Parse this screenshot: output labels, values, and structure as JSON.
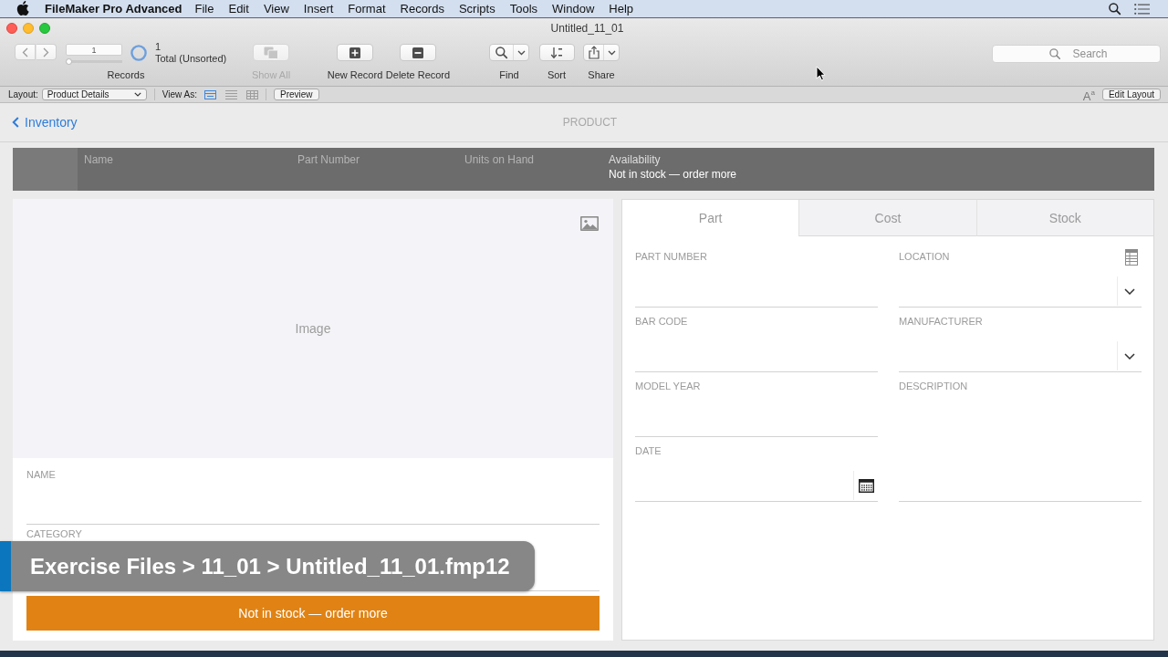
{
  "menubar": {
    "app": "FileMaker Pro Advanced",
    "menus": [
      "File",
      "Edit",
      "View",
      "Insert",
      "Format",
      "Records",
      "Scripts",
      "Tools",
      "Window",
      "Help"
    ]
  },
  "window": {
    "title": "Untitled_11_01"
  },
  "toolbar": {
    "record_number": "1",
    "record_slider": {
      "level": 0
    },
    "found_count": "1",
    "found_status": "Total (Unsorted)",
    "records_label": "Records",
    "buttons": [
      {
        "kind": "show_all",
        "label": "Show All",
        "disabled": true
      },
      {
        "kind": "new_record",
        "label": "New Record",
        "disabled": false
      },
      {
        "kind": "delete_record",
        "label": "Delete Record",
        "disabled": false
      },
      {
        "kind": "find",
        "label": "Find",
        "disabled": false
      },
      {
        "kind": "sort",
        "label": "Sort",
        "disabled": false
      },
      {
        "kind": "share",
        "label": "Share",
        "disabled": false
      }
    ],
    "search": {
      "placeholder": "Search"
    }
  },
  "layout_bar": {
    "layout_label": "Layout:",
    "layout": "Product Details",
    "view_as_label": "View As:",
    "views": [
      {
        "kind": "form",
        "selected": true
      },
      {
        "kind": "list",
        "selected": false
      },
      {
        "kind": "table",
        "selected": false
      }
    ],
    "preview": "Preview",
    "text_format": "A$^{a}$",
    "edit_layout": "Edit Layout"
  },
  "nav": {
    "back": "Inventory",
    "title": "PRODUCT"
  },
  "list_header": {
    "columns": [
      "Name",
      "Part Number",
      "Units on Hand"
    ],
    "availability_label": "Availability",
    "availability": "Not in stock — order more"
  },
  "image_container": {
    "label": "Image"
  },
  "fields": [
    {
      "label": "NAME"
    },
    {
      "label": "CATEGORY"
    }
  ],
  "status_button": "Not in stock — order more",
  "tabs": [
    {
      "label": "Part",
      "selected": true
    },
    {
      "label": "Cost",
      "selected": false
    },
    {
      "label": "Stock",
      "selected": false
    }
  ],
  "part_fields": [
    {
      "label": "PART NUMBER",
      "kind": "text"
    },
    {
      "label": "LOCATION",
      "kind": "dropdown_list"
    },
    {
      "label": "BAR CODE",
      "kind": "text"
    },
    {
      "label": "MANUFACTURER",
      "kind": "dropdown"
    },
    {
      "label": "MODEL YEAR",
      "kind": "text"
    },
    {
      "label": "DESCRIPTION",
      "kind": "multiline"
    },
    {
      "label": "DATE",
      "kind": "date"
    }
  ],
  "caption": "Exercise Files > 11_01 > Untitled_11_01.fmp12"
}
